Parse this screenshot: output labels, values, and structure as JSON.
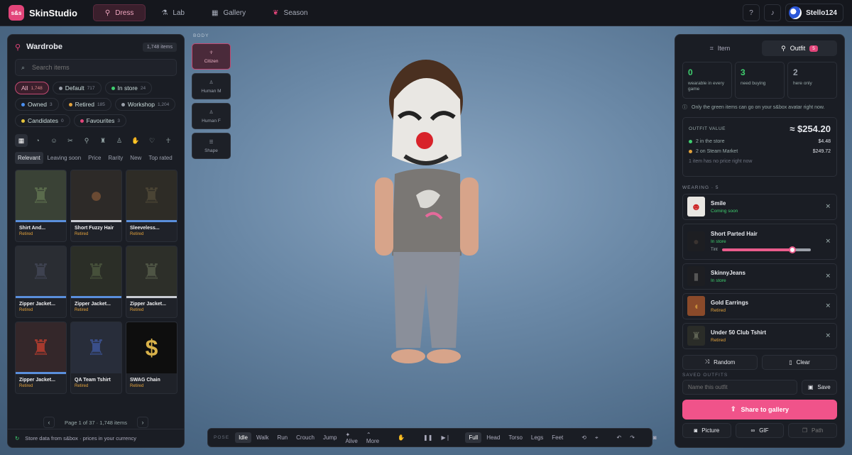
{
  "app": {
    "logo": "s&s",
    "name": "SkinStudio"
  },
  "nav": [
    {
      "label": "Dress",
      "icon": "hanger-icon"
    },
    {
      "label": "Lab",
      "icon": "flask-icon"
    },
    {
      "label": "Gallery",
      "icon": "grid-icon"
    },
    {
      "label": "Season",
      "icon": "gift-icon"
    }
  ],
  "user": {
    "name": "Stello124"
  },
  "wardrobe": {
    "title": "Wardrobe",
    "count": "1,748 items",
    "search_placeholder": "Search items",
    "filters": [
      {
        "label": "All",
        "count": "1,748",
        "color": ""
      },
      {
        "label": "Default",
        "count": "717",
        "color": "#9aa0aa"
      },
      {
        "label": "In store",
        "count": "24",
        "color": "#3fcf6f"
      },
      {
        "label": "Owned",
        "count": "3",
        "color": "#4a8ff0"
      },
      {
        "label": "Retired",
        "count": "185",
        "color": "#e3a23b"
      },
      {
        "label": "Workshop",
        "count": "1,204",
        "color": "#9aa0aa"
      },
      {
        "label": "Candidates",
        "count": "0",
        "color": "#e3c23b"
      },
      {
        "label": "Favourites",
        "count": "3",
        "color": "#e2457a"
      }
    ],
    "sorts": [
      "Relevant",
      "Leaving soon",
      "Price",
      "Rarity",
      "New",
      "Top rated"
    ],
    "items": [
      {
        "name": "Shirt And...",
        "status": "Retired"
      },
      {
        "name": "Short Fuzzy Hair",
        "status": "Retired"
      },
      {
        "name": "Sleeveless...",
        "status": "Retired"
      },
      {
        "name": "Zipper Jacket...",
        "status": "Retired"
      },
      {
        "name": "Zipper Jacket...",
        "status": "Retired"
      },
      {
        "name": "Zipper Jacket...",
        "status": "Retired"
      },
      {
        "name": "Zipper Jacket...",
        "status": "Retired"
      },
      {
        "name": "QA Team Tshirt",
        "status": "Retired"
      },
      {
        "name": "SWAG Chain",
        "status": "Retired"
      }
    ],
    "pager": "Page 1 of 37 · 1,748 items",
    "footer": "Store data from s&box · prices in your currency"
  },
  "body": {
    "label": "BODY",
    "options": [
      {
        "label": "Citizen"
      },
      {
        "label": "Human M"
      },
      {
        "label": "Human F"
      },
      {
        "label": "Shape"
      }
    ]
  },
  "toolbar": {
    "pose_label": "POSE",
    "poses": [
      "Idle",
      "Walk",
      "Run",
      "Crouch",
      "Jump",
      "Alive",
      "More"
    ],
    "views": [
      "Full",
      "Head",
      "Torso",
      "Legs",
      "Feet"
    ]
  },
  "outfit": {
    "tabs": [
      {
        "label": "Item"
      },
      {
        "label": "Outfit",
        "badge": "5"
      }
    ],
    "stats": [
      {
        "value": "0",
        "desc": "wearable in every game",
        "color": "#3fcf6f"
      },
      {
        "value": "3",
        "desc": "need buying",
        "color": "#3fcf6f"
      },
      {
        "value": "2",
        "desc": "here only",
        "color": "#9aa0aa"
      }
    ],
    "note": "Only the green items can go on your s&box avatar right now.",
    "value": {
      "label": "OUTFIT VALUE",
      "total": "≈ $254.20",
      "lines": [
        {
          "label": "2 in the store",
          "amount": "$4.48",
          "color": "#3fcf6f"
        },
        {
          "label": "2 on Steam Market",
          "amount": "$249.72",
          "color": "#e3a23b"
        }
      ],
      "note": "1 item has no price right now"
    },
    "wearing_label": "WEARING · 5",
    "wearing": [
      {
        "name": "Smile",
        "status": "Coming soon",
        "color": "#3fcf6f"
      },
      {
        "name": "Short Parted Hair",
        "status": "In store",
        "color": "#3fcf6f",
        "tint": "Tint",
        "tint_level": 0.78
      },
      {
        "name": "SkinnyJeans",
        "status": "In store",
        "color": "#3fcf6f"
      },
      {
        "name": "Gold Earrings",
        "status": "Retired",
        "color": "#e3a23b"
      },
      {
        "name": "Under 50 Club Tshirt",
        "status": "Retired",
        "color": "#e3a23b"
      }
    ],
    "random": "Random",
    "clear": "Clear",
    "saved_label": "SAVED OUTFITS",
    "name_placeholder": "Name this outfit",
    "save": "Save",
    "share": "Share to gallery",
    "picture": "Picture",
    "gif": "GIF",
    "path": "Path"
  }
}
